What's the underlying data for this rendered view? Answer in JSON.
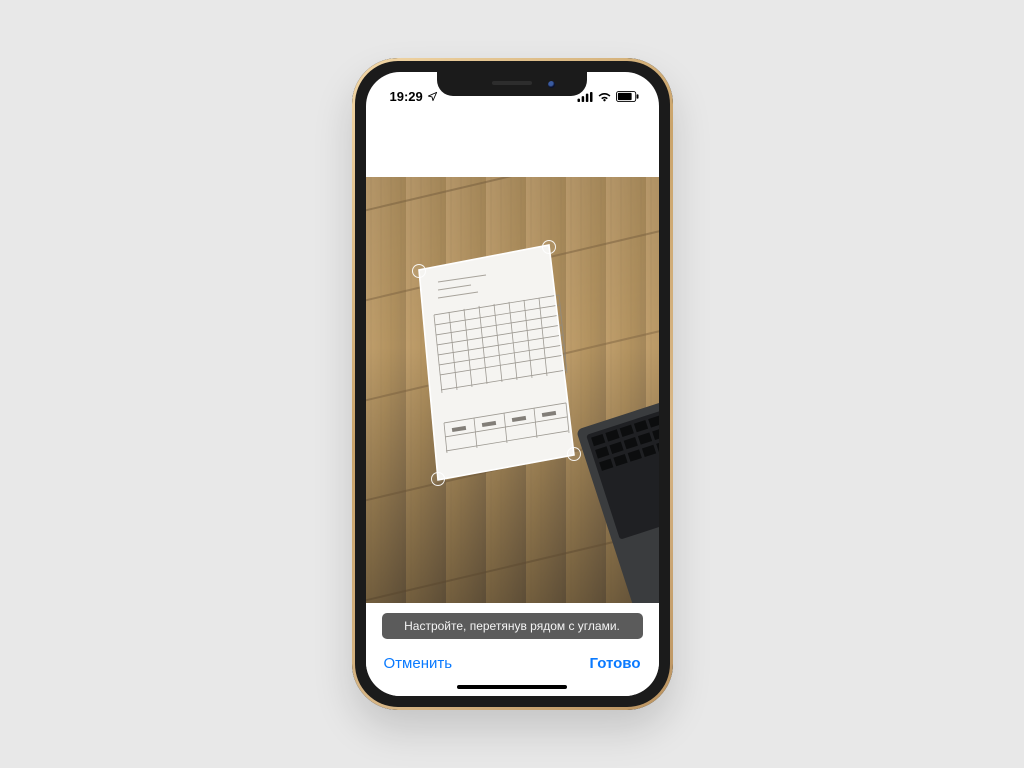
{
  "status": {
    "time": "19:29",
    "location_icon": "location-arrow",
    "signal_icon": "cellular-signal",
    "wifi_icon": "wifi",
    "battery_icon": "battery"
  },
  "scan": {
    "hint": "Настройте, перетянув рядом с углами."
  },
  "actions": {
    "cancel": "Отменить",
    "done": "Готово"
  },
  "colors": {
    "accent": "#0a7aff",
    "page_bg": "#e8e8e8",
    "hint_bg": "#5b5b5b"
  }
}
